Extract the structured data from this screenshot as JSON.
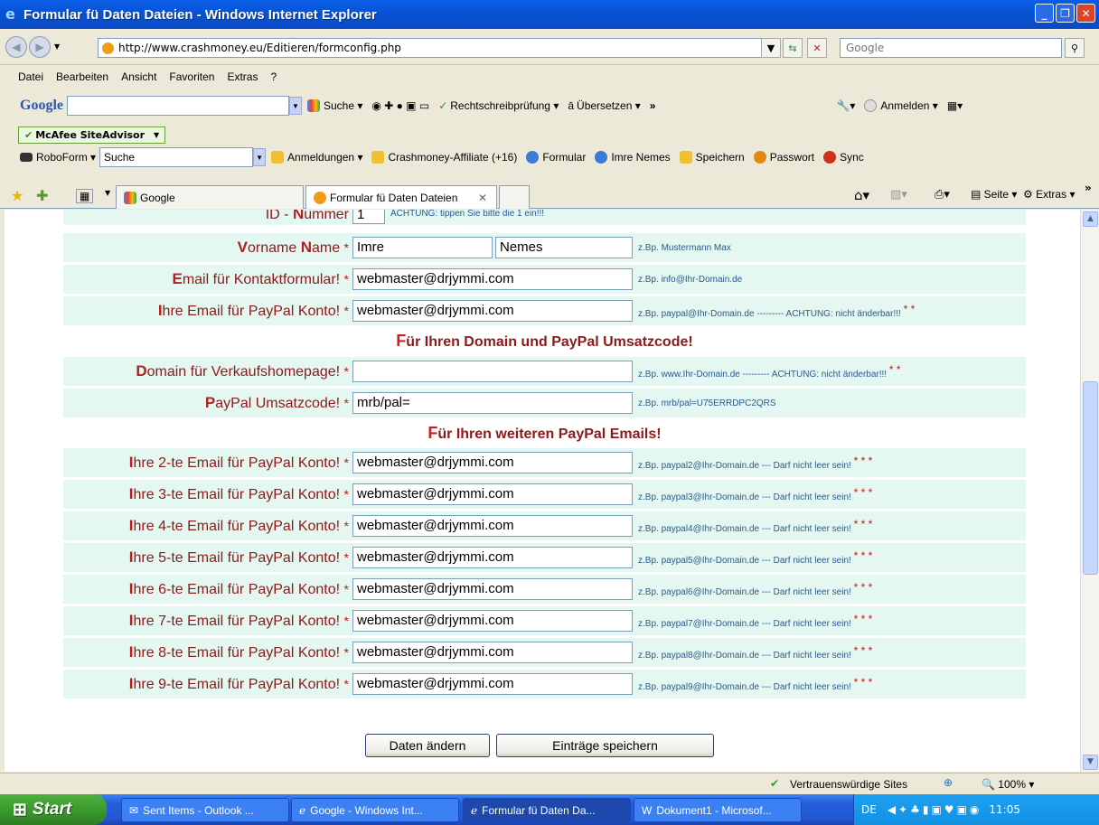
{
  "window": {
    "title": "Formular fü Daten Dateien - Windows Internet Explorer"
  },
  "address": {
    "url": "http://www.crashmoney.eu/Editieren/formconfig.php",
    "search_placeholder": "Google"
  },
  "menu": [
    "Datei",
    "Bearbeiten",
    "Ansicht",
    "Favoriten",
    "Extras",
    "?"
  ],
  "google_toolbar": {
    "logo": "Google",
    "search": "Suche",
    "spell": "Rechtschreibprüfung",
    "translate": "Übersetzen",
    "signin": "Anmelden",
    "more": "»"
  },
  "mcafee": {
    "label": "McAfee SiteAdvisor"
  },
  "roboform": {
    "label": "RoboForm",
    "search": "Suche",
    "items": [
      "Anmeldungen",
      "Crashmoney-Affiliate (+16)",
      "Formular",
      "Imre Nemes",
      "Speichern",
      "Passwort",
      "Sync"
    ]
  },
  "tabs": [
    {
      "label": "Google"
    },
    {
      "label": "Formular fü Daten Dateien"
    }
  ],
  "cmdbar": {
    "page": "Seite",
    "extras": "Extras"
  },
  "form": {
    "id_row": {
      "label_first": "ID - ",
      "label_b": "N",
      "label_rest": "ummer",
      "value": "1",
      "hint": "ACHTUNG: tippen Sie bitte die 1 ein!!!"
    },
    "name_row": {
      "label_a": "V",
      "label_b": "orname ",
      "label_c": "N",
      "label_d": "ame",
      "first": "Imre",
      "last": "Nemes",
      "hint": "z.Bp. Mustermann Max"
    },
    "contact_row": {
      "initial": "E",
      "rest": "mail für Kontaktformular!",
      "value": "webmaster@drjymmi.com",
      "hint": "z.Bp. info@Ihr-Domain.de"
    },
    "paypal_row": {
      "initial": "I",
      "rest": "hre Email für PayPal Konto!",
      "value": "webmaster@drjymmi.com",
      "hint": "z.Bp. paypal@Ihr-Domain.de --------- ACHTUNG: nicht änderbar!!!",
      "stars": "* *"
    },
    "section1": {
      "initial": "F",
      "rest": "ür Ihren Domain und PayPal Umsatzcode!"
    },
    "domain_row": {
      "initial": "D",
      "rest": "omain für Verkaufshomepage!",
      "value": "",
      "hint": "z.Bp. www.Ihr-Domain.de --------- ACHTUNG: nicht änderbar!!!",
      "stars": "* *"
    },
    "umsatz_row": {
      "initial": "P",
      "rest": "ayPal Umsatzcode!",
      "value": "mrb/pal=",
      "hint": "z.Bp. mrb/pal=U75ERRDPC2QRS"
    },
    "section2": {
      "initial": "F",
      "rest": "ür Ihren weiteren PayPal Emails!"
    },
    "extra_emails": [
      {
        "initial": "I",
        "rest": "hre 2-te Email für PayPal Konto!",
        "value": "webmaster@drjymmi.com",
        "hint": "z.Bp. paypal2@Ihr-Domain.de --- Darf nicht leer sein!",
        "stars": "* * *"
      },
      {
        "initial": "I",
        "rest": "hre 3-te Email für PayPal Konto!",
        "value": "webmaster@drjymmi.com",
        "hint": "z.Bp. paypal3@Ihr-Domain.de --- Darf nicht leer sein!",
        "stars": "* * *"
      },
      {
        "initial": "I",
        "rest": "hre 4-te Email für PayPal Konto!",
        "value": "webmaster@drjymmi.com",
        "hint": "z.Bp. paypal4@Ihr-Domain.de --- Darf nicht leer sein!",
        "stars": "* * *"
      },
      {
        "initial": "I",
        "rest": "hre 5-te Email für PayPal Konto!",
        "value": "webmaster@drjymmi.com",
        "hint": "z.Bp. paypal5@Ihr-Domain.de --- Darf nicht leer sein!",
        "stars": "* * *"
      },
      {
        "initial": "I",
        "rest": "hre 6-te Email für PayPal Konto!",
        "value": "webmaster@drjymmi.com",
        "hint": "z.Bp. paypal6@Ihr-Domain.de --- Darf nicht leer sein!",
        "stars": "* * *"
      },
      {
        "initial": "I",
        "rest": "hre 7-te Email für PayPal Konto!",
        "value": "webmaster@drjymmi.com",
        "hint": "z.Bp. paypal7@Ihr-Domain.de --- Darf nicht leer sein!",
        "stars": "* * *"
      },
      {
        "initial": "I",
        "rest": "hre 8-te Email für PayPal Konto!",
        "value": "webmaster@drjymmi.com",
        "hint": "z.Bp. paypal8@Ihr-Domain.de --- Darf nicht leer sein!",
        "stars": "* * *"
      },
      {
        "initial": "I",
        "rest": "hre 9-te Email für PayPal Konto!",
        "value": "webmaster@drjymmi.com",
        "hint": "z.Bp. paypal9@Ihr-Domain.de --- Darf nicht leer sein!",
        "stars": "* * *"
      }
    ],
    "required_mark": "*",
    "buttons": {
      "change": "Daten ändern",
      "save": "Einträge speichern"
    }
  },
  "status": {
    "trusted": "Vertrauenswürdige Sites",
    "zoom": "100%"
  },
  "taskbar": {
    "start": "Start",
    "items": [
      "Sent Items - Outlook ...",
      "Google - Windows Int...",
      "Formular fü Daten Da...",
      "Dokument1 - Microsof..."
    ],
    "lang": "DE",
    "clock": "11:05"
  },
  "colors": {
    "label": "#8b1a1a",
    "accent": "#cc2020",
    "row_bg": "#e5f7f1",
    "hint": "#2a5a8a"
  }
}
